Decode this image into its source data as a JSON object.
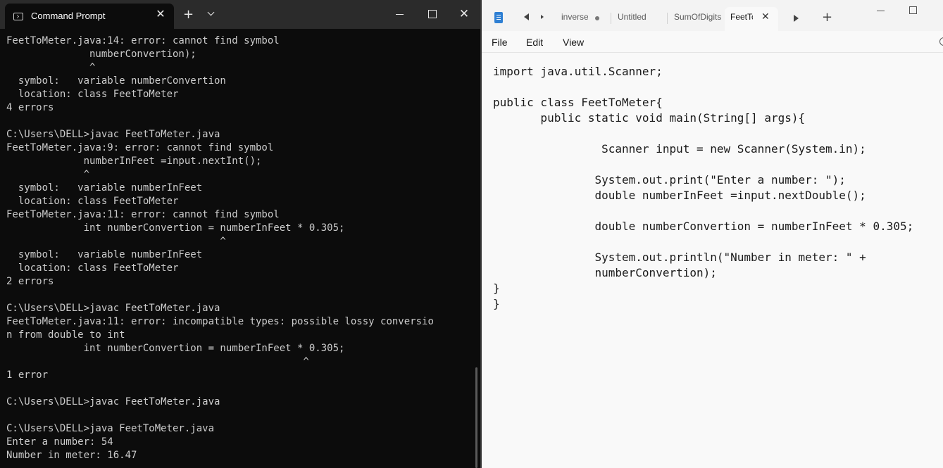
{
  "terminal": {
    "tab_title": "Command Prompt",
    "close_glyph": "✕",
    "new_tab_glyph": "+",
    "close_window_glyph": "✕",
    "output": "FeetToMeter.java:14: error: cannot find symbol\n              numberConvertion);\n              ^\n  symbol:   variable numberConvertion\n  location: class FeetToMeter\n4 errors\n\nC:\\Users\\DELL>javac FeetToMeter.java\nFeetToMeter.java:9: error: cannot find symbol\n             numberInFeet =input.nextInt();\n             ^\n  symbol:   variable numberInFeet\n  location: class FeetToMeter\nFeetToMeter.java:11: error: cannot find symbol\n             int numberConvertion = numberInFeet * 0.305;\n                                    ^\n  symbol:   variable numberInFeet\n  location: class FeetToMeter\n2 errors\n\nC:\\Users\\DELL>javac FeetToMeter.java\nFeetToMeter.java:11: error: incompatible types: possible lossy conversio\nn from double to int\n             int numberConvertion = numberInFeet * 0.305;\n                                                  ^\n1 error\n\nC:\\Users\\DELL>javac FeetToMeter.java\n\nC:\\Users\\DELL>java FeetToMeter.java\nEnter a number: 54\nNumber in meter: 16.47"
  },
  "notepad": {
    "tabs": [
      {
        "label": "inverse",
        "unsaved": true
      },
      {
        "label": "Untitled"
      },
      {
        "label": "SumOfDigits"
      },
      {
        "label": "FeetToMeter",
        "active": true
      }
    ],
    "tab_close_glyph": "✕",
    "new_tab_glyph": "+",
    "menu": {
      "file": "File",
      "edit": "Edit",
      "view": "View"
    },
    "editor_text": "import java.util.Scanner;\n\npublic class FeetToMeter{\n       public static void main(String[] args){\n\n                Scanner input = new Scanner(System.in);\n\n               System.out.print(\"Enter a number: \");\n               double numberInFeet =input.nextDouble();\n\n               double numberConvertion = numberInFeet * 0.305;\n\n               System.out.println(\"Number in meter: \" +\n               numberConvertion);\n}\n}"
  }
}
